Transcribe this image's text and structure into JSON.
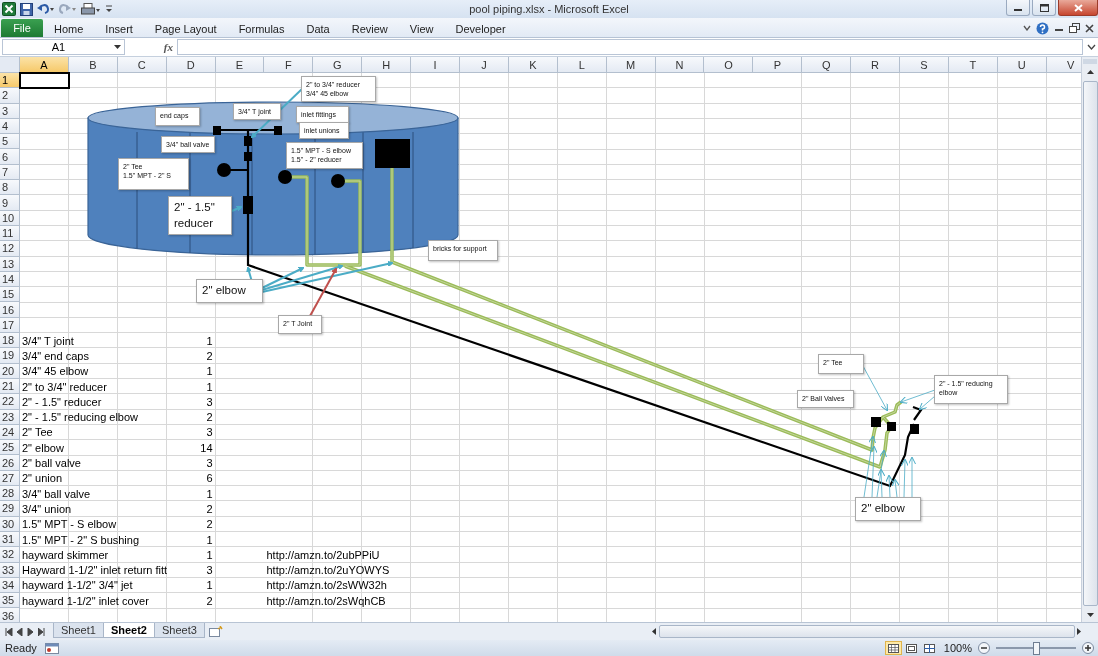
{
  "window": {
    "title": "pool piping.xlsx - Microsoft Excel"
  },
  "ribbon_tabs": [
    {
      "label": "File",
      "kind": "file"
    },
    {
      "label": "Home",
      "kind": "tab"
    },
    {
      "label": "Insert",
      "kind": "tab"
    },
    {
      "label": "Page Layout",
      "kind": "tab"
    },
    {
      "label": "Formulas",
      "kind": "tab"
    },
    {
      "label": "Data",
      "kind": "tab"
    },
    {
      "label": "Review",
      "kind": "tab"
    },
    {
      "label": "View",
      "kind": "tab"
    },
    {
      "label": "Developer",
      "kind": "tab"
    }
  ],
  "formula_bar": {
    "name_box": "A1",
    "function_button": "fx"
  },
  "sheet": {
    "columns": [
      {
        "label": "A",
        "selected": true
      },
      {
        "label": "B",
        "selected": false
      },
      {
        "label": "C",
        "selected": false
      },
      {
        "label": "D",
        "selected": false
      },
      {
        "label": "E",
        "selected": false
      },
      {
        "label": "F",
        "selected": false
      },
      {
        "label": "G",
        "selected": false
      },
      {
        "label": "H",
        "selected": false
      },
      {
        "label": "I",
        "selected": false
      },
      {
        "label": "J",
        "selected": false
      },
      {
        "label": "K",
        "selected": false
      },
      {
        "label": "L",
        "selected": false
      },
      {
        "label": "M",
        "selected": false
      },
      {
        "label": "N",
        "selected": false
      },
      {
        "label": "O",
        "selected": false
      },
      {
        "label": "P",
        "selected": false
      },
      {
        "label": "Q",
        "selected": false
      },
      {
        "label": "R",
        "selected": false
      },
      {
        "label": "S",
        "selected": false
      },
      {
        "label": "T",
        "selected": false
      },
      {
        "label": "U",
        "selected": false
      },
      {
        "label": "V",
        "selected": false
      }
    ],
    "rows": [
      {
        "number": "1",
        "selected": true
      },
      {
        "number": "2",
        "selected": false
      },
      {
        "number": "3",
        "selected": false
      },
      {
        "number": "4",
        "selected": false
      },
      {
        "number": "5",
        "selected": false
      },
      {
        "number": "6",
        "selected": false
      },
      {
        "number": "7",
        "selected": false
      },
      {
        "number": "8",
        "selected": false
      },
      {
        "number": "9",
        "selected": false
      },
      {
        "number": "10",
        "selected": false
      },
      {
        "number": "11",
        "selected": false
      },
      {
        "number": "12",
        "selected": false
      },
      {
        "number": "13",
        "selected": false
      },
      {
        "number": "14",
        "selected": false
      },
      {
        "number": "15",
        "selected": false
      },
      {
        "number": "16",
        "selected": false
      },
      {
        "number": "17",
        "selected": false
      },
      {
        "number": "18",
        "selected": false,
        "item": "3/4\" T joint",
        "quantity": "1"
      },
      {
        "number": "19",
        "selected": false,
        "item": "3/4\" end caps",
        "quantity": "2"
      },
      {
        "number": "20",
        "selected": false,
        "item": "3/4\" 45 elbow",
        "quantity": "1"
      },
      {
        "number": "21",
        "selected": false,
        "item": "2\" to 3/4\" reducer",
        "quantity": "1"
      },
      {
        "number": "22",
        "selected": false,
        "item": "2\" - 1.5\" reducer",
        "quantity": "3"
      },
      {
        "number": "23",
        "selected": false,
        "item": "2\" - 1.5\" reducing elbow",
        "quantity": "2"
      },
      {
        "number": "24",
        "selected": false,
        "item": "2\" Tee",
        "quantity": "3"
      },
      {
        "number": "25",
        "selected": false,
        "item": "2\" elbow",
        "quantity": "14"
      },
      {
        "number": "26",
        "selected": false,
        "item": "2\" ball valve",
        "quantity": "3"
      },
      {
        "number": "27",
        "selected": false,
        "item": "2\" union",
        "quantity": "6"
      },
      {
        "number": "28",
        "selected": false,
        "item": "3/4\" ball valve",
        "quantity": "1"
      },
      {
        "number": "29",
        "selected": false,
        "item": "3/4\" union",
        "quantity": "2"
      },
      {
        "number": "30",
        "selected": false,
        "item": "1.5\" MPT - S elbow",
        "quantity": "2"
      },
      {
        "number": "31",
        "selected": false,
        "item": "1.5\" MPT - 2\" S bushing",
        "quantity": "1"
      },
      {
        "number": "32",
        "selected": false,
        "item": "hayward skimmer",
        "quantity": "1",
        "link": "http://amzn.to/2ubPPiU"
      },
      {
        "number": "33",
        "selected": false,
        "item": "Hayward 1-1/2\" inlet return fitt",
        "quantity": "3",
        "link": "http://amzn.to/2uYOWYS"
      },
      {
        "number": "34",
        "selected": false,
        "item": "hayward 1-1/2\" 3/4\" jet",
        "quantity": "1",
        "link": "http://amzn.to/2sWW32h"
      },
      {
        "number": "35",
        "selected": false,
        "item": "hayward 1-1/2\" inlet cover",
        "quantity": "2",
        "link": "http://amzn.to/2sWqhCB"
      },
      {
        "number": "36",
        "selected": false
      }
    ]
  },
  "drawing": {
    "callouts": [
      {
        "text": "2\" to 3/4\" reducer\n3/4\" 45 elbow",
        "kind": "small"
      },
      {
        "text": "end caps",
        "kind": "small"
      },
      {
        "text": "3/4\" T joint",
        "kind": "small"
      },
      {
        "text": "inlet fittings",
        "kind": "small"
      },
      {
        "text": "inlet unions",
        "kind": "small"
      },
      {
        "text": "3/4\" ball valve",
        "kind": "small"
      },
      {
        "text": "1.5\" MPT - S elbow\n1.5\" - 2\" reducer",
        "kind": "small"
      },
      {
        "text": "2\" Tee\n1.5\" MPT - 2\" S",
        "kind": "small"
      },
      {
        "text": "2\" - 1.5\"\nreducer",
        "kind": "large"
      },
      {
        "text": "bricks for support",
        "kind": "small"
      },
      {
        "text": "2\" elbow",
        "kind": "large"
      },
      {
        "text": "2\" T Joint",
        "kind": "small"
      },
      {
        "text": "2\" Tee",
        "kind": "small"
      },
      {
        "text": "2\" Ball Valves",
        "kind": "small"
      },
      {
        "text": "2\" - 1.5\" reducing\nelbow",
        "kind": "small"
      },
      {
        "text": "2\" elbow",
        "kind": "large"
      }
    ]
  },
  "sheet_tabs": [
    {
      "label": "Sheet1",
      "selected": false
    },
    {
      "label": "Sheet2",
      "selected": true
    },
    {
      "label": "Sheet3",
      "selected": false
    }
  ],
  "status_bar": {
    "status": "Ready",
    "views": [
      {
        "kind": "normal",
        "selected": true
      },
      {
        "kind": "page_layout",
        "selected": false
      },
      {
        "kind": "page_break",
        "selected": false
      }
    ],
    "zoom": "100%",
    "zoom_slider": {
      "level": 0.5
    }
  }
}
